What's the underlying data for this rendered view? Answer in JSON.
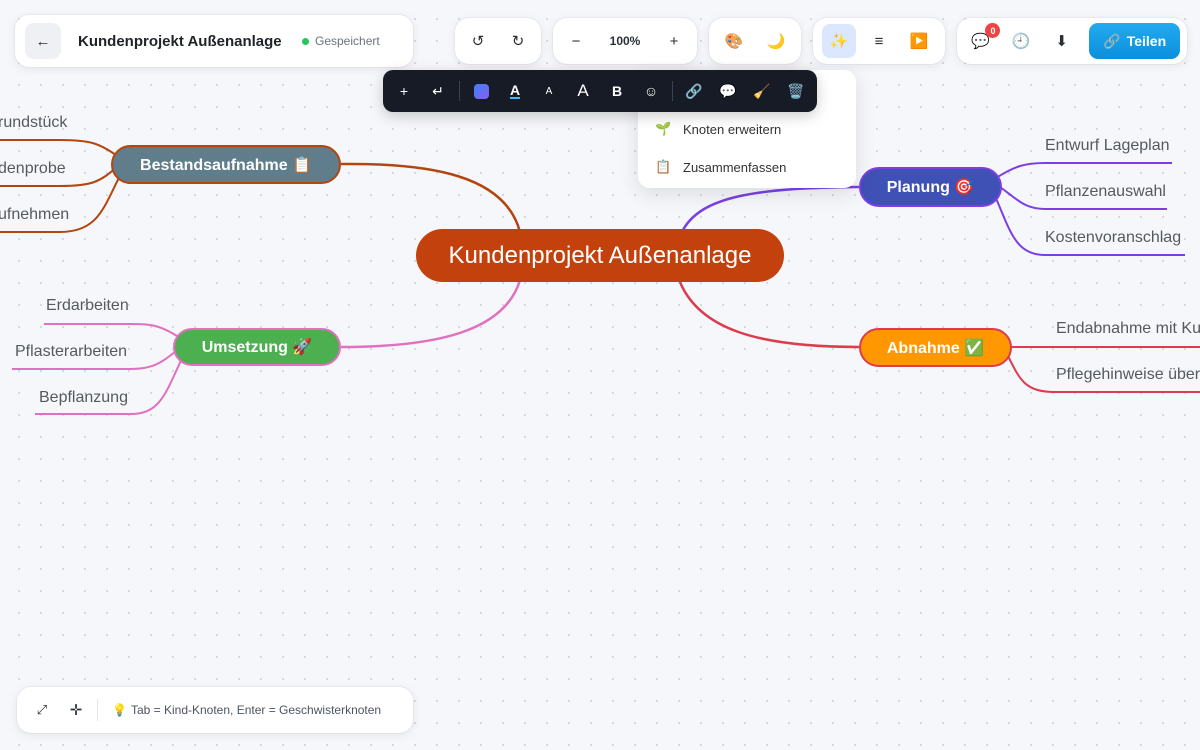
{
  "header": {
    "back_icon": "arrow-left-icon",
    "title": "Kundenprojekt Außenanlage",
    "save_status": "Gespeichert",
    "status_color": "#22c55e"
  },
  "toolbar": {
    "undo": "↺",
    "redo": "↻",
    "zoom_out": "−",
    "zoom_level": "100%",
    "zoom_in": "+",
    "theme_icon": "🎨",
    "dark_mode_icon": "🌙",
    "ai_icon": "✨",
    "outline_icon": "≡",
    "present_icon": "▶️",
    "comments_icon": "💬",
    "comments_count": "0",
    "history_icon": "🕘",
    "download_icon": "⬇",
    "share_icon": "🔗",
    "share_label": "Teilen",
    "share_color": "#0c8fdc"
  },
  "format_toolbar": {
    "add_child": "+",
    "add_sibling": "↵",
    "text_color": "A",
    "font_smaller": "A",
    "font_larger": "A",
    "bold": "B",
    "emoji": "☺",
    "link": "🔗",
    "note": "💬",
    "clear_format": "🧹",
    "delete": "🗑️"
  },
  "ai_menu": {
    "items": [
      {
        "icon": "🌱",
        "label": "Knoten erweitern"
      },
      {
        "icon": "📋",
        "label": "Zusammenfassen"
      }
    ]
  },
  "mindmap": {
    "central": {
      "label": "Kundenprojekt Außenanlage",
      "color": "#c2410c"
    },
    "branches": [
      {
        "label": "Bestandsaufnahme 📋",
        "color": "#607d8b",
        "edge": "#b3450f",
        "children": [
          "rundstück",
          "denprobe",
          "ufnehmen"
        ]
      },
      {
        "label": "Umsetzung 🚀",
        "color": "#4caf50",
        "edge": "#e070c0",
        "children": [
          "Erdarbeiten",
          "Pflasterarbeiten",
          "Bepflanzung"
        ]
      },
      {
        "label": "Planung 🎯",
        "color": "#3f51b5",
        "edge": "#7b3fe4",
        "children": [
          "Entwurf Lageplan",
          "Pflanzenauswahl",
          "Kostenvoranschlag"
        ]
      },
      {
        "label": "Abnahme ✅",
        "color": "#ff9800",
        "edge": "#dc3c4e",
        "children": [
          "Endabnahme mit Ku",
          "Pflegehinweise über"
        ]
      }
    ]
  },
  "bottom_bar": {
    "fit_icon": "⤢",
    "center_icon": "✛",
    "hint_icon": "💡",
    "hint": "Tab = Kind-Knoten, Enter = Geschwisterknoten"
  }
}
